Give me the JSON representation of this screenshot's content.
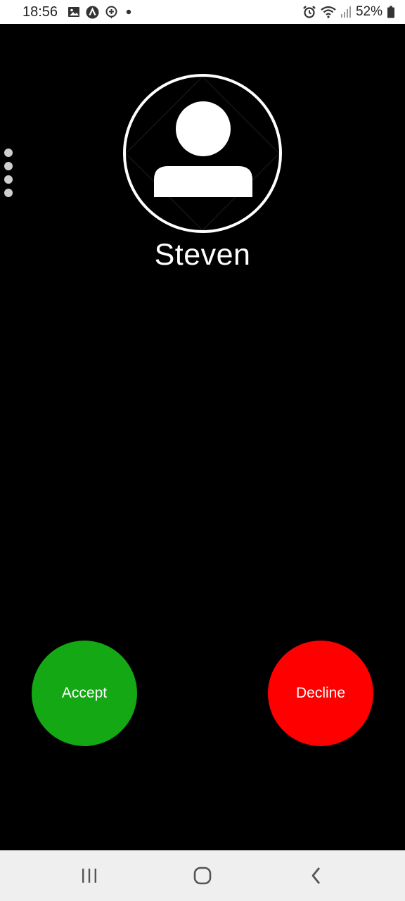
{
  "status_bar": {
    "time": "18:56",
    "battery_percent": "52%",
    "left_icons": [
      "image-icon",
      "a-circle-icon",
      "location-plus-icon",
      "dot-icon"
    ],
    "right_icons": [
      "alarm-icon",
      "wifi-icon",
      "signal-icon",
      "battery-icon"
    ]
  },
  "call": {
    "caller_name": "Steven",
    "accept_label": "Accept",
    "decline_label": "Decline"
  },
  "colors": {
    "accept": "#14a814",
    "decline": "#ff0000",
    "background": "#000000"
  },
  "nav_bar": {
    "buttons": [
      "recents-icon",
      "home-icon",
      "back-icon"
    ]
  }
}
